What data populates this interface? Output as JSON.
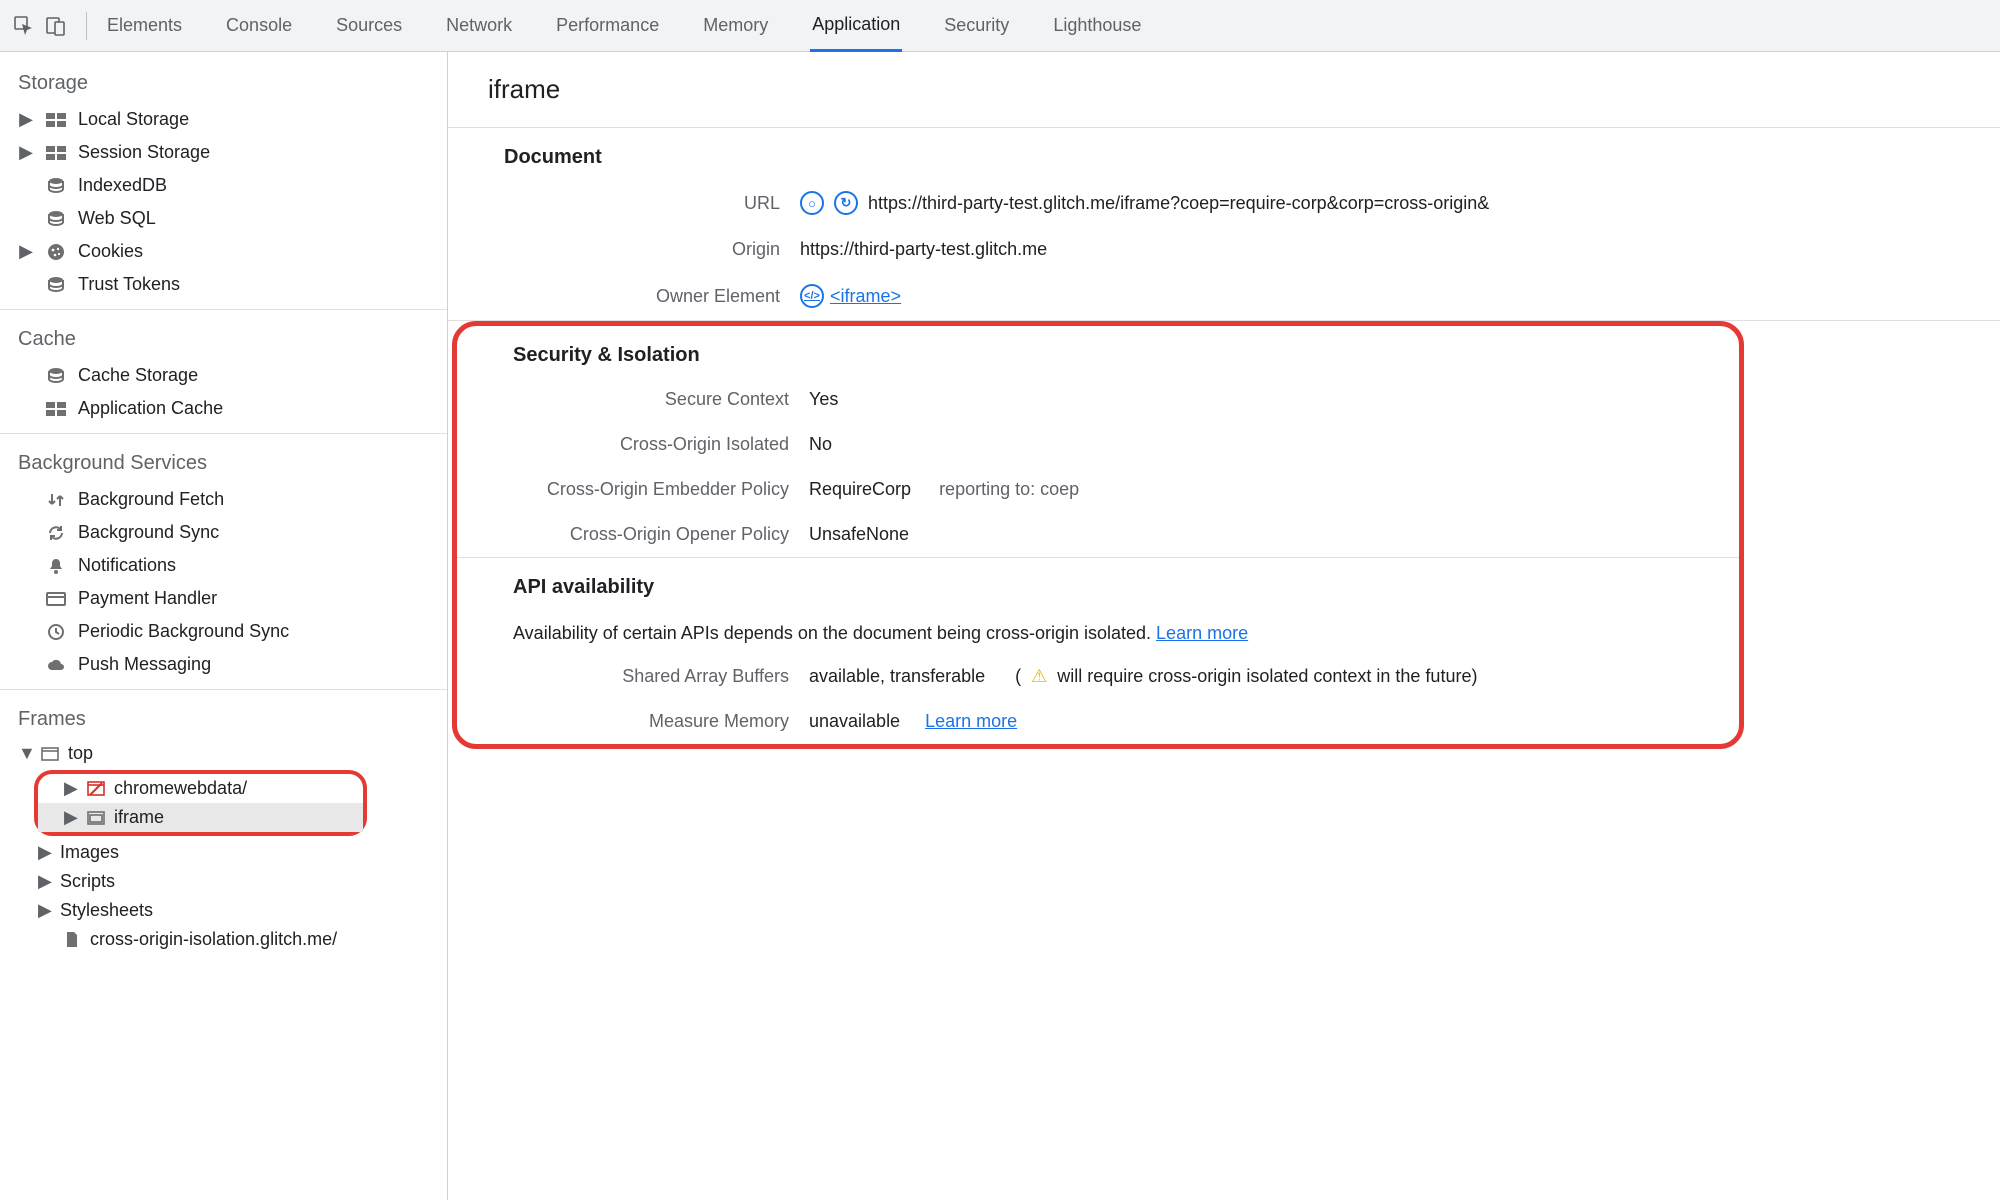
{
  "toolbar": {
    "tabs": [
      {
        "label": "Elements"
      },
      {
        "label": "Console"
      },
      {
        "label": "Sources"
      },
      {
        "label": "Network"
      },
      {
        "label": "Performance"
      },
      {
        "label": "Memory"
      },
      {
        "label": "Application",
        "active": true
      },
      {
        "label": "Security"
      },
      {
        "label": "Lighthouse"
      }
    ]
  },
  "sidebar": {
    "storage": {
      "title": "Storage",
      "items": [
        {
          "label": "Local Storage",
          "expandable": true,
          "icon": "db-grid"
        },
        {
          "label": "Session Storage",
          "expandable": true,
          "icon": "db-grid"
        },
        {
          "label": "IndexedDB",
          "icon": "db"
        },
        {
          "label": "Web SQL",
          "icon": "db"
        },
        {
          "label": "Cookies",
          "expandable": true,
          "icon": "cookie"
        },
        {
          "label": "Trust Tokens",
          "icon": "db"
        }
      ]
    },
    "cache": {
      "title": "Cache",
      "items": [
        {
          "label": "Cache Storage",
          "icon": "db"
        },
        {
          "label": "Application Cache",
          "icon": "db-grid"
        }
      ]
    },
    "bg": {
      "title": "Background Services",
      "items": [
        {
          "label": "Background Fetch",
          "icon": "fetch"
        },
        {
          "label": "Background Sync",
          "icon": "sync"
        },
        {
          "label": "Notifications",
          "icon": "bell"
        },
        {
          "label": "Payment Handler",
          "icon": "card"
        },
        {
          "label": "Periodic Background Sync",
          "icon": "clock"
        },
        {
          "label": "Push Messaging",
          "icon": "cloud"
        }
      ]
    },
    "frames": {
      "title": "Frames",
      "tree": {
        "top": "top",
        "children": [
          {
            "label": "chromewebdata/",
            "icon": "restricted"
          },
          {
            "label": "iframe",
            "icon": "frame",
            "selected": true
          },
          {
            "label": "Images"
          },
          {
            "label": "Scripts"
          },
          {
            "label": "Stylesheets"
          },
          {
            "label": "cross-origin-isolation.glitch.me/",
            "icon": "file",
            "leaf": true
          }
        ]
      }
    }
  },
  "main": {
    "title": "iframe",
    "doc": {
      "heading": "Document",
      "url_label": "URL",
      "url_value": "https://third-party-test.glitch.me/iframe?coep=require-corp&corp=cross-origin&",
      "origin_label": "Origin",
      "origin_value": "https://third-party-test.glitch.me",
      "owner_label": "Owner Element",
      "owner_value": "<iframe>"
    },
    "sec": {
      "heading": "Security & Isolation",
      "secure_context_label": "Secure Context",
      "secure_context_value": "Yes",
      "coi_label": "Cross-Origin Isolated",
      "coi_value": "No",
      "coep_label": "Cross-Origin Embedder Policy",
      "coep_value": "RequireCorp",
      "coep_reporting": "reporting to: coep",
      "coop_label": "Cross-Origin Opener Policy",
      "coop_value": "UnsafeNone"
    },
    "api": {
      "heading": "API availability",
      "desc": "Availability of certain APIs depends on the document being cross-origin isolated. ",
      "learn_more": "Learn more",
      "sab_label": "Shared Array Buffers",
      "sab_value": "available, transferable",
      "sab_hint_open": "(",
      "sab_hint": " will require cross-origin isolated context in the future)",
      "mm_label": "Measure Memory",
      "mm_value": "unavailable"
    }
  }
}
